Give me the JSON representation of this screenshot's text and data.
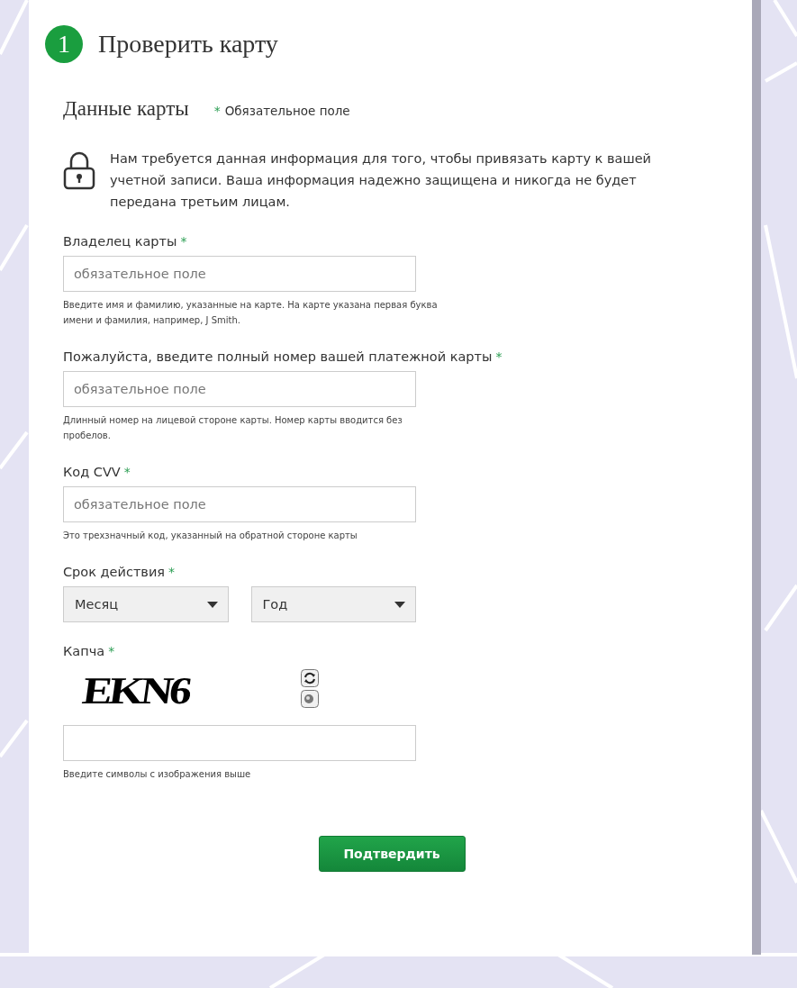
{
  "step": {
    "number": "1",
    "title": "Проверить карту"
  },
  "section": {
    "title": "Данные карты",
    "required_mark": "*",
    "required_note": "Обязательное поле"
  },
  "notice": "Нам требуется данная информация для того, чтобы привязать карту к вашей учетной записи. Ваша информация надежно защищена и никогда не будет передана третьим лицам.",
  "fields": [
    {
      "kind": "text",
      "label": "Владелец карты",
      "mark": "*",
      "placeholder": "обязательное поле",
      "hint": "Введите имя и фамилию, указанные на карте. На карте указана первая буква имени и фамилия, например, J Smith."
    },
    {
      "kind": "text",
      "label": "Пожалуйста, введите полный номер вашей платежной карты",
      "mark": "*",
      "placeholder": "обязательное поле",
      "hint": "Длинный номер на лицевой стороне карты. Номер карты вводится без пробелов."
    },
    {
      "kind": "text",
      "label": "Код CVV",
      "mark": "*",
      "placeholder": "обязательное поле",
      "hint": "Это трехзначный код, указанный на обратной стороне карты"
    },
    {
      "kind": "selects",
      "label": "Срок действия",
      "mark": "*",
      "selects": [
        {
          "value": "Месяц"
        },
        {
          "value": "Год"
        }
      ]
    },
    {
      "kind": "captcha",
      "label": "Капча",
      "mark": "*",
      "captcha_text": "EKN6",
      "hint": "Введите символы с изображения выше"
    }
  ],
  "submit": "Подтвердить"
}
